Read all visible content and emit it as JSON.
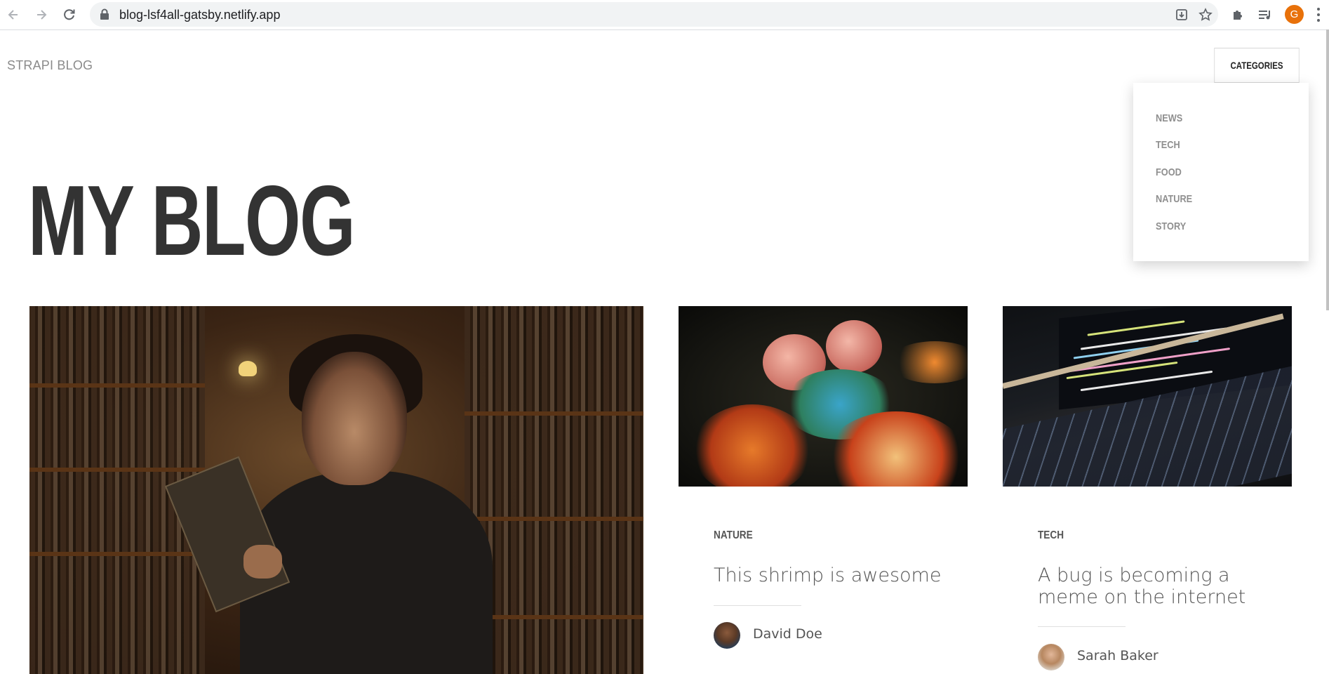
{
  "browser": {
    "url": "blog-lsf4all-gatsby.netlify.app",
    "profile_initial": "G",
    "icons": [
      "back-arrow-icon",
      "forward-arrow-icon",
      "reload-icon",
      "lock-icon",
      "install-app-icon",
      "bookmark-star-icon",
      "extensions-puzzle-icon",
      "reading-list-icon",
      "more-menu-icon"
    ]
  },
  "header": {
    "brand": "STRAPI BLOG",
    "categories_button": "CATEGORIES"
  },
  "dropdown": {
    "items": [
      "NEWS",
      "TECH",
      "FOOD",
      "NATURE",
      "STORY"
    ]
  },
  "hero": {
    "title": "MY BLOG"
  },
  "articles": [
    {
      "category": "NATURE",
      "title": "This shrimp is awesome",
      "author": "David Doe",
      "image": "mantis-shrimp-photo"
    },
    {
      "category": "TECH",
      "title": "A bug is becoming a meme on the internet",
      "author": "Sarah Baker",
      "image": "laptop-code-photo"
    }
  ],
  "featured": {
    "image": "man-in-library-photo"
  }
}
